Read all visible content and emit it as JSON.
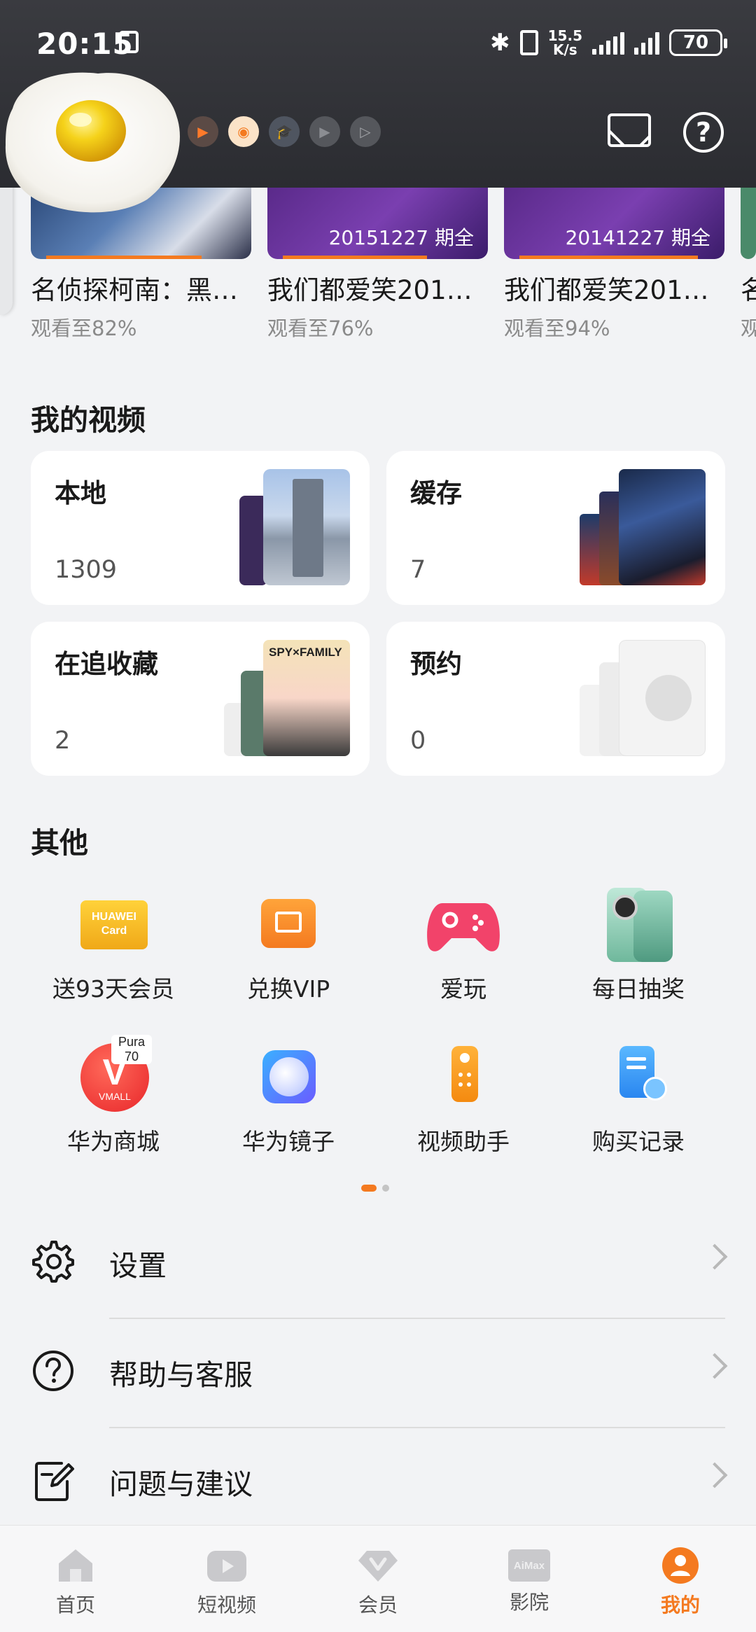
{
  "status_bar": {
    "time": "20:15",
    "net_speed_value": "15.5",
    "net_speed_unit": "K/s",
    "battery": "70"
  },
  "header": {
    "mail_icon": "mail-icon",
    "help_icon": "help-icon"
  },
  "history": [
    {
      "title": "名侦探柯南：黑…",
      "progress_text": "观看至82%",
      "progress": 0.82,
      "episode": ""
    },
    {
      "title": "我们都爱笑201…",
      "progress_text": "观看至76%",
      "progress": 0.76,
      "episode": "20151227 期全"
    },
    {
      "title": "我们都爱笑201…",
      "progress_text": "观看至94%",
      "progress": 0.94,
      "episode": "20141227 期全"
    },
    {
      "title": "名",
      "progress_text": "观",
      "progress": 0.3,
      "episode": ""
    }
  ],
  "my_videos": {
    "title": "我的视频",
    "cards": [
      {
        "label": "本地",
        "count": "1309"
      },
      {
        "label": "缓存",
        "count": "7"
      },
      {
        "label": "在追收藏",
        "count": "2"
      },
      {
        "label": "预约",
        "count": "0"
      }
    ],
    "spy_cover_text": "SPY×FAMILY"
  },
  "others": {
    "title": "其他",
    "items": [
      {
        "label": "送93天会员",
        "icon": "huawei-card-icon",
        "icon_text": "HUAWEI Card"
      },
      {
        "label": "兑换VIP",
        "icon": "vip-ticket-icon"
      },
      {
        "label": "爱玩",
        "icon": "gamepad-icon"
      },
      {
        "label": "每日抽奖",
        "icon": "phone-prize-icon"
      },
      {
        "label": "华为商城",
        "icon": "vmall-icon",
        "icon_text": "VMALL",
        "badge": "Pura 70"
      },
      {
        "label": "华为镜子",
        "icon": "mirror-icon"
      },
      {
        "label": "视频助手",
        "icon": "remote-icon"
      },
      {
        "label": "购买记录",
        "icon": "purchase-record-icon"
      }
    ]
  },
  "menu": [
    {
      "label": "设置",
      "icon": "gear-icon"
    },
    {
      "label": "帮助与客服",
      "icon": "help-circle-icon"
    },
    {
      "label": "问题与建议",
      "icon": "feedback-icon"
    }
  ],
  "bottom_nav": [
    {
      "label": "首页",
      "icon": "home-icon"
    },
    {
      "label": "短视频",
      "icon": "short-video-icon"
    },
    {
      "label": "会员",
      "icon": "vip-diamond-icon"
    },
    {
      "label": "影院",
      "icon": "aimax-icon",
      "icon_text": "AiMax"
    },
    {
      "label": "我的",
      "icon": "profile-icon",
      "active": true
    }
  ],
  "colors": {
    "accent": "#f47a20",
    "header_bg": "#2f3035",
    "page_bg": "#f2f3f5"
  }
}
